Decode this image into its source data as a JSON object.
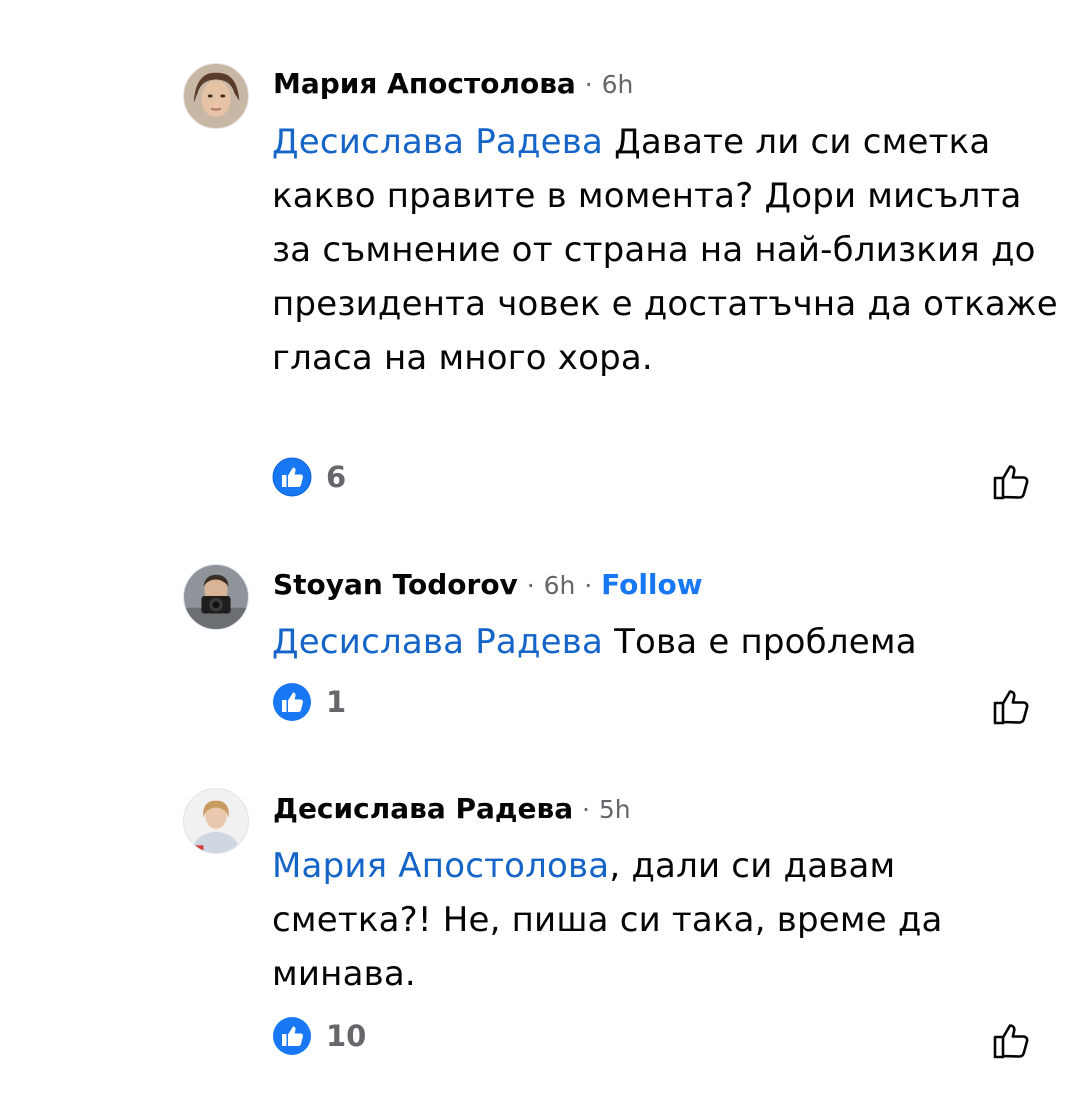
{
  "comments": [
    {
      "author": "Мария Апостолова",
      "time": "6h",
      "mention": "Десислава Радева",
      "text": "Давате ли си сметка какво правите в момента? Дори мисълта за съмнение от страна на  най-близкия до президента човек е достатъчна да откаже гласа на много хора.",
      "reaction_count": "6",
      "avatar_icon": "profile-photo"
    },
    {
      "author": "Stoyan Todorov",
      "time": "6h",
      "follow_label": "Follow",
      "mention": "Десислава Радева",
      "text": "Това е проблема",
      "reaction_count": "1",
      "avatar_icon": "profile-photo"
    },
    {
      "author": "Десислава Радева",
      "time": "5h",
      "mention": "Мария Апостолова",
      "text": ", дали си давам сметка?! Не, пиша си така, време да минава.",
      "reaction_count": "10",
      "avatar_icon": "profile-photo"
    }
  ],
  "separator": "·",
  "colors": {
    "accent": "#1877f2",
    "mention": "#1565c8",
    "meta_gray": "#65676b",
    "text": "#050505"
  }
}
